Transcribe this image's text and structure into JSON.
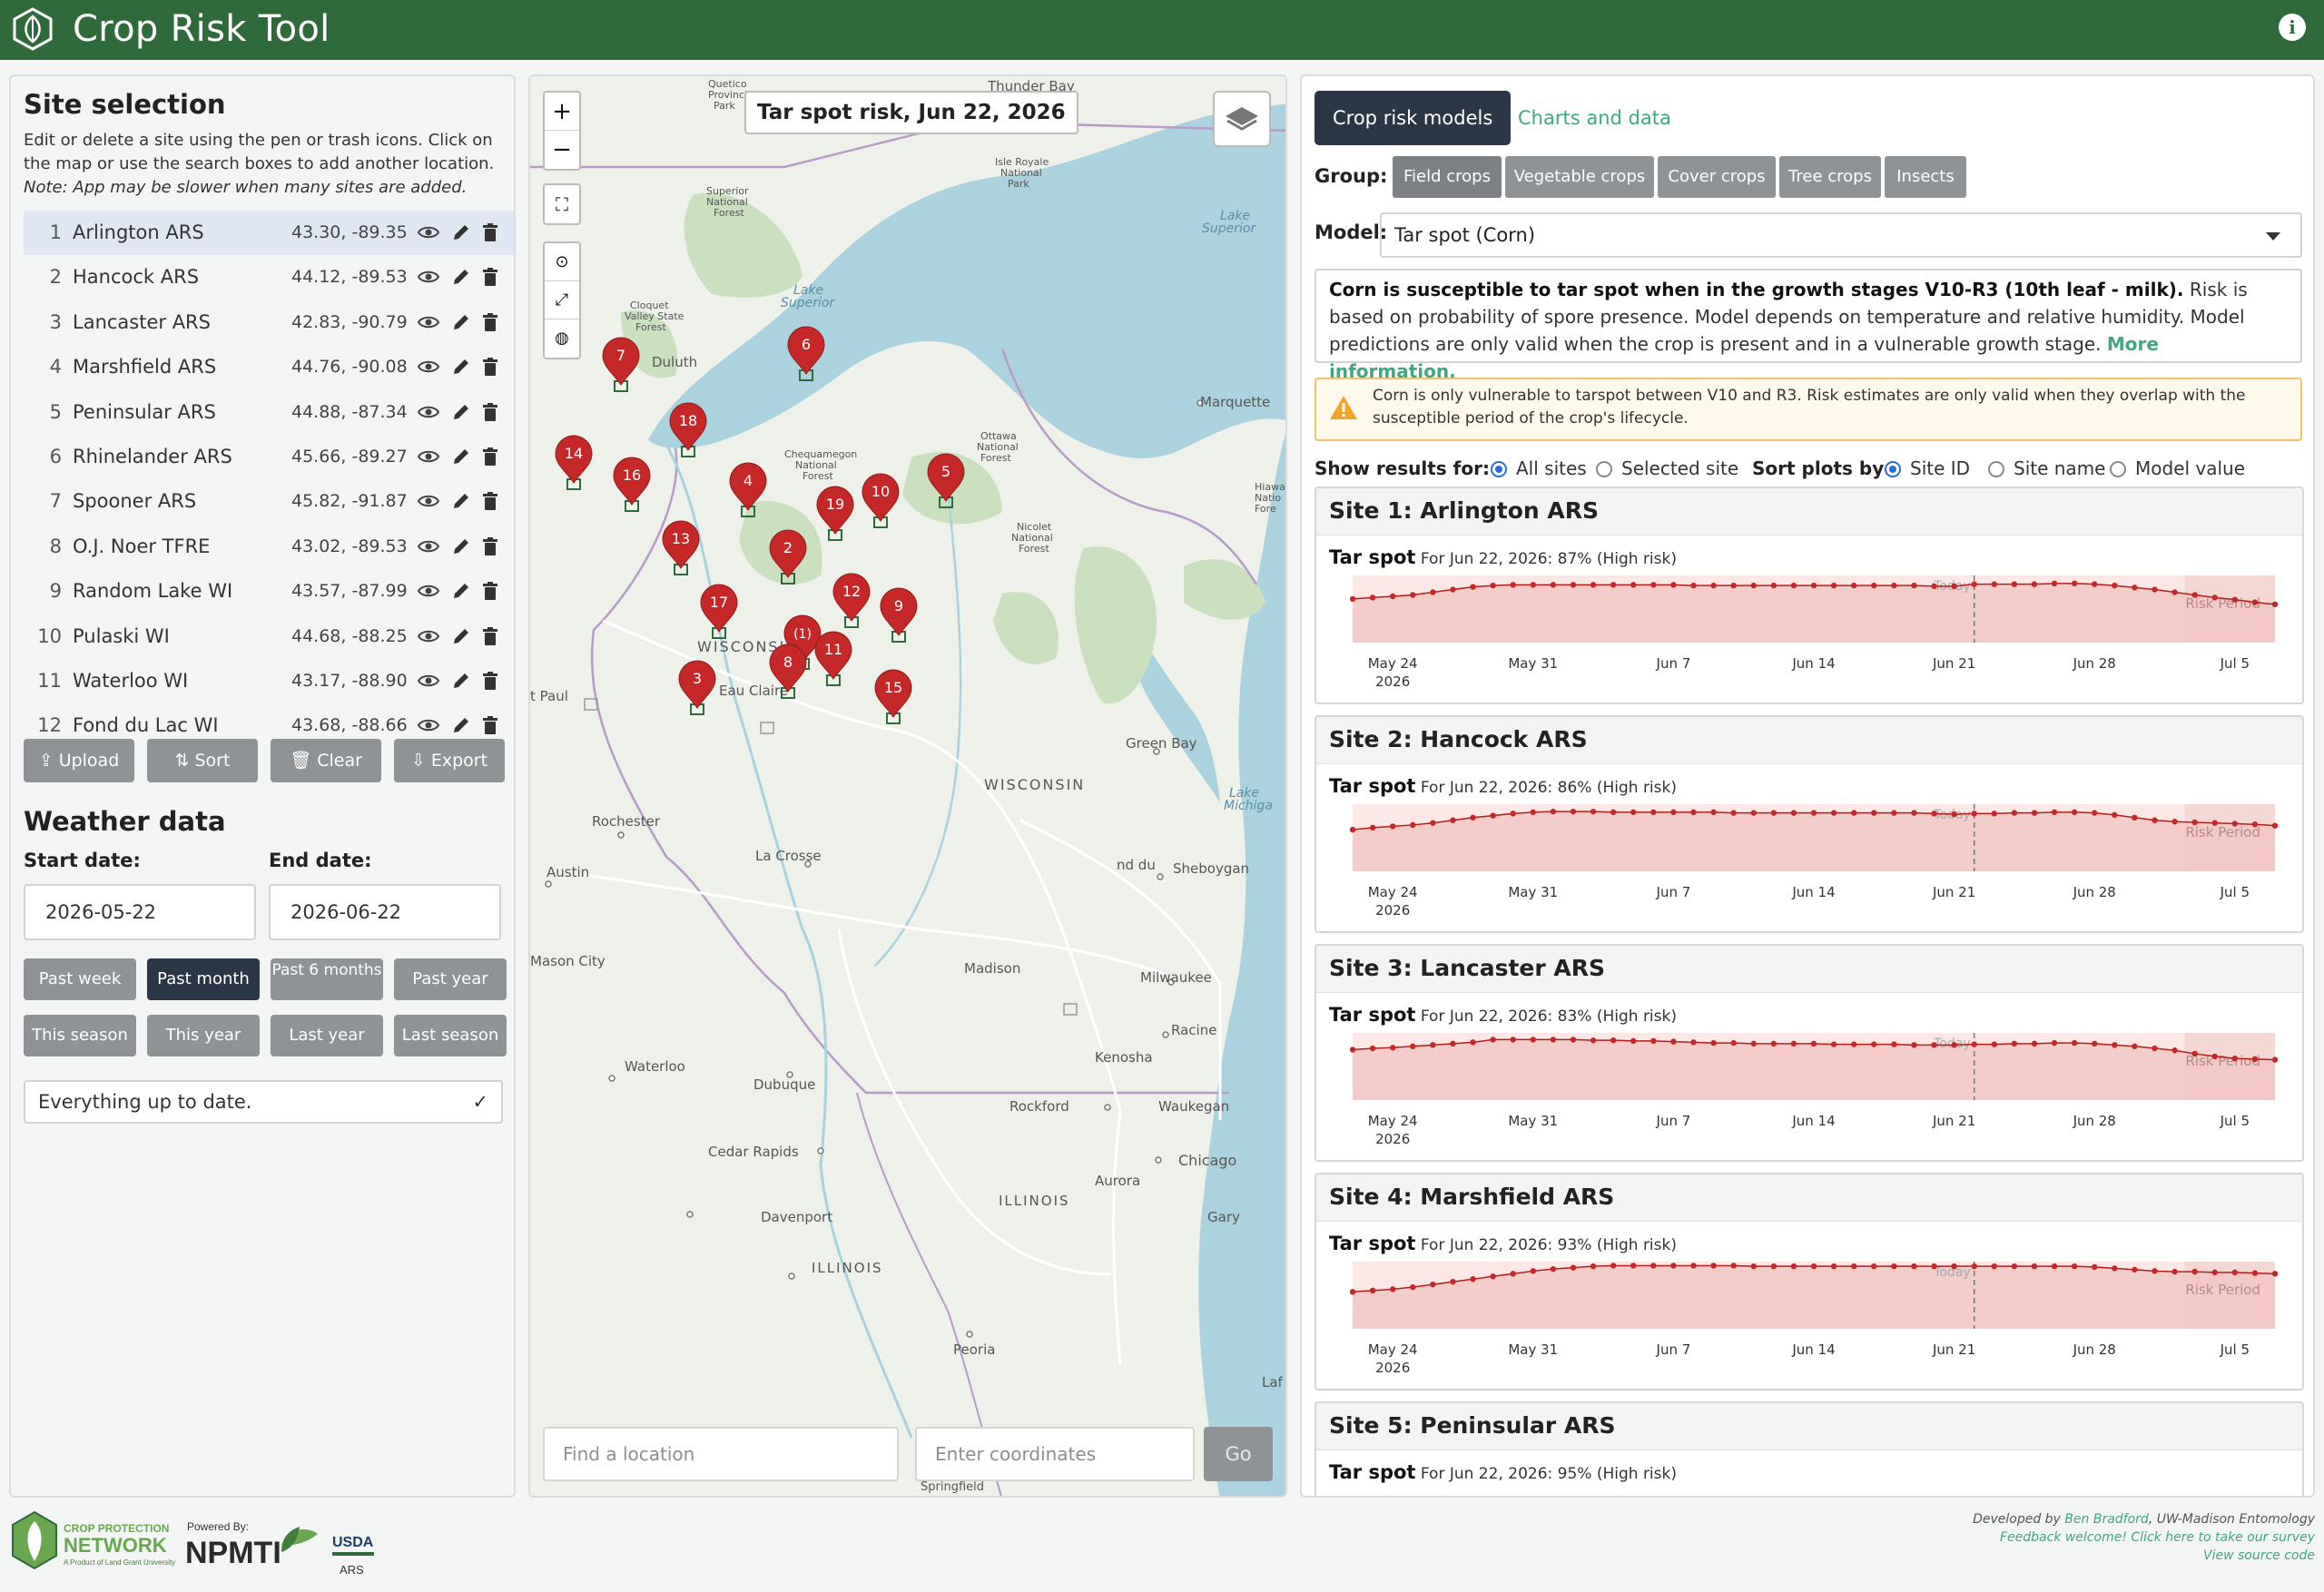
{
  "app": {
    "title": "Crop Risk Tool"
  },
  "site_selection": {
    "heading": "Site selection",
    "help_a": "Edit or delete a site using the pen or trash icons. Click on the map or use the search boxes to add another location.",
    "help_note": "Note: App may be slower when many sites are added.",
    "sites": [
      {
        "num": "1",
        "name": "Arlington ARS",
        "coords": "43.30, -89.35"
      },
      {
        "num": "2",
        "name": "Hancock ARS",
        "coords": "44.12, -89.53"
      },
      {
        "num": "3",
        "name": "Lancaster ARS",
        "coords": "42.83, -90.79"
      },
      {
        "num": "4",
        "name": "Marshfield ARS",
        "coords": "44.76, -90.08"
      },
      {
        "num": "5",
        "name": "Peninsular ARS",
        "coords": "44.88, -87.34"
      },
      {
        "num": "6",
        "name": "Rhinelander ARS",
        "coords": "45.66, -89.27"
      },
      {
        "num": "7",
        "name": "Spooner ARS",
        "coords": "45.82, -91.87"
      },
      {
        "num": "8",
        "name": "O.J. Noer TFRE",
        "coords": "43.02, -89.53"
      },
      {
        "num": "9",
        "name": "Random Lake WI",
        "coords": "43.57, -87.99"
      },
      {
        "num": "10",
        "name": "Pulaski WI",
        "coords": "44.68, -88.25"
      },
      {
        "num": "11",
        "name": "Waterloo WI",
        "coords": "43.17, -88.90"
      },
      {
        "num": "12",
        "name": "Fond du Lac WI",
        "coords": "43.68, -88.66"
      }
    ],
    "buttons": {
      "upload": "Upload",
      "sort": "Sort",
      "clear": "Clear",
      "export": "Export"
    }
  },
  "weather": {
    "heading": "Weather data",
    "start_label": "Start date:",
    "end_label": "End date:",
    "start_value": "2026-05-22",
    "end_value": "2026-06-22",
    "presets": [
      "Past week",
      "Past month",
      "Past 6 months",
      "Past year",
      "This season",
      "This year",
      "Last year",
      "Last season"
    ],
    "active_preset": "Past month",
    "status": "Everything up to date."
  },
  "map": {
    "title": "Tar spot risk, Jun 22, 2026",
    "search_placeholder": "Find a location",
    "coords_placeholder": "Enter coordinates",
    "go": "Go",
    "labels": [
      "Thunder Bay",
      "Lake Superior",
      "Duluth",
      "Marquette",
      "WISCONSIN",
      "Eau Claire",
      "Green Bay",
      "Rochester",
      "La Crosse",
      "Austin",
      "Sheboygan",
      "Madison",
      "Milwaukee",
      "Racine",
      "Kenosha",
      "Mason City",
      "Waterloo",
      "Dubuque",
      "Rockford",
      "Waukegan",
      "Chicago",
      "Cedar Rapids",
      "Aurora",
      "ILLINOIS",
      "Davenport",
      "Gary",
      "Peoria",
      "Lake Michigan",
      "St Paul",
      "Isle Royale National Park",
      "Quetico Provincial Park",
      "Superior National Forest",
      "Cloquet Valley State Forest",
      "Chequamegon National Forest",
      "Ottawa National Forest",
      "Nicolet National Forest",
      "Hiawatha National Forest",
      "Springfield"
    ],
    "pins": [
      "7",
      "6",
      "18",
      "14",
      "16",
      "4",
      "19",
      "10",
      "5",
      "13",
      "2",
      "12",
      "17",
      "9",
      "(1)",
      "11",
      "8",
      "3",
      "15"
    ]
  },
  "results": {
    "tabs": [
      "Crop risk models",
      "Charts and data"
    ],
    "active_tab": "Crop risk models",
    "group_label": "Group:",
    "groups": [
      "Field crops",
      "Vegetable crops",
      "Cover crops",
      "Tree crops",
      "Insects"
    ],
    "active_group": "Field crops",
    "model_label": "Model:",
    "model_value": "Tar spot (Corn)",
    "desc_bold": "Corn is susceptible to tar spot when in the growth stages V10-R3 (10th leaf - milk).",
    "desc_text": " Risk is based on probability of spore presence. Model depends on temperature and relative humidity. Model predictions are only valid when the crop is present and in a vulnerable growth stage. ",
    "desc_link": "More information.",
    "warning": "Corn is only vulnerable to tarspot between V10 and R3. Risk estimates are only valid when they overlap with the susceptible period of the crop's lifecycle.",
    "show_label": "Show results for:",
    "show_options": [
      "All sites",
      "Selected site"
    ],
    "show_selected": "All sites",
    "sort_label": "Sort plots by:",
    "sort_options": [
      "Site ID",
      "Site name",
      "Model value"
    ],
    "sort_selected": "Site ID",
    "chart_model": "Tar spot",
    "today_label": "Today",
    "risk_label": "Risk Period",
    "x_ticks": [
      "May 24",
      "May 31",
      "Jun 7",
      "Jun 14",
      "Jun 21",
      "Jun 28",
      "Jul 5"
    ],
    "x_year": "2026"
  },
  "chart_data": [
    {
      "type": "line",
      "title": "Site 1: Arlington ARS",
      "subtitle": "For Jun 22, 2026: 87% (High risk)",
      "x": [
        "May 22",
        "May 23",
        "May 24",
        "May 25",
        "May 26",
        "May 27",
        "May 28",
        "May 29",
        "May 30",
        "May 31",
        "Jun 1",
        "Jun 2",
        "Jun 3",
        "Jun 4",
        "Jun 5",
        "Jun 6",
        "Jun 7",
        "Jun 8",
        "Jun 9",
        "Jun 10",
        "Jun 11",
        "Jun 12",
        "Jun 13",
        "Jun 14",
        "Jun 15",
        "Jun 16",
        "Jun 17",
        "Jun 18",
        "Jun 19",
        "Jun 20",
        "Jun 21",
        "Jun 22",
        "Jun 23",
        "Jun 24",
        "Jun 25",
        "Jun 26",
        "Jun 27",
        "Jun 28",
        "Jun 29",
        "Jun 30",
        "Jul 1",
        "Jul 2",
        "Jul 3",
        "Jul 4",
        "Jul 5",
        "Jul 6",
        "Jul 7"
      ],
      "values": [
        65,
        67,
        69,
        71,
        75,
        79,
        83,
        85,
        86,
        86,
        86,
        86,
        86,
        86,
        86,
        86,
        86,
        85,
        85,
        85,
        85,
        85,
        85,
        85,
        85,
        85,
        85,
        85,
        85,
        84,
        84,
        87,
        87,
        87,
        87,
        88,
        88,
        87,
        85,
        82,
        79,
        75,
        71,
        67,
        64,
        60,
        57
      ]
    },
    {
      "type": "line",
      "title": "Site 2: Hancock ARS",
      "subtitle": "For Jun 22, 2026: 86% (High risk)",
      "x": [
        "May 22",
        "May 23",
        "May 24",
        "May 25",
        "May 26",
        "May 27",
        "May 28",
        "May 29",
        "May 30",
        "May 31",
        "Jun 1",
        "Jun 2",
        "Jun 3",
        "Jun 4",
        "Jun 5",
        "Jun 6",
        "Jun 7",
        "Jun 8",
        "Jun 9",
        "Jun 10",
        "Jun 11",
        "Jun 12",
        "Jun 13",
        "Jun 14",
        "Jun 15",
        "Jun 16",
        "Jun 17",
        "Jun 18",
        "Jun 19",
        "Jun 20",
        "Jun 21",
        "Jun 22",
        "Jun 23",
        "Jun 24",
        "Jun 25",
        "Jun 26",
        "Jun 27",
        "Jun 28",
        "Jun 29",
        "Jun 30",
        "Jul 1",
        "Jul 2",
        "Jul 3",
        "Jul 4",
        "Jul 5",
        "Jul 6",
        "Jul 7"
      ],
      "values": [
        62,
        65,
        67,
        69,
        72,
        76,
        80,
        83,
        86,
        88,
        89,
        89,
        89,
        88,
        88,
        88,
        88,
        88,
        88,
        87,
        87,
        87,
        87,
        87,
        87,
        87,
        87,
        87,
        87,
        86,
        85,
        86,
        86,
        87,
        87,
        88,
        88,
        87,
        84,
        80,
        76,
        74,
        73,
        72,
        71,
        70,
        68
      ]
    },
    {
      "type": "line",
      "title": "Site 3: Lancaster ARS",
      "subtitle": "For Jun 22, 2026: 83% (High risk)",
      "x": [
        "May 22",
        "May 23",
        "May 24",
        "May 25",
        "May 26",
        "May 27",
        "May 28",
        "May 29",
        "May 30",
        "May 31",
        "Jun 1",
        "Jun 2",
        "Jun 3",
        "Jun 4",
        "Jun 5",
        "Jun 6",
        "Jun 7",
        "Jun 8",
        "Jun 9",
        "Jun 10",
        "Jun 11",
        "Jun 12",
        "Jun 13",
        "Jun 14",
        "Jun 15",
        "Jun 16",
        "Jun 17",
        "Jun 18",
        "Jun 19",
        "Jun 20",
        "Jun 21",
        "Jun 22",
        "Jun 23",
        "Jun 24",
        "Jun 25",
        "Jun 26",
        "Jun 27",
        "Jun 28",
        "Jun 29",
        "Jun 30",
        "Jul 1",
        "Jul 2",
        "Jul 3",
        "Jul 4",
        "Jul 5",
        "Jul 6",
        "Jul 7"
      ],
      "values": [
        75,
        77,
        78,
        80,
        82,
        84,
        86,
        90,
        90,
        90,
        90,
        90,
        89,
        89,
        88,
        88,
        87,
        86,
        85,
        85,
        84,
        84,
        84,
        84,
        83,
        83,
        83,
        83,
        82,
        82,
        82,
        83,
        83,
        84,
        84,
        85,
        85,
        84,
        82,
        80,
        77,
        74,
        69,
        65,
        62,
        61,
        60
      ]
    },
    {
      "type": "line",
      "title": "Site 4: Marshfield ARS",
      "subtitle": "For Jun 22, 2026: 93% (High risk)",
      "x": [
        "May 22",
        "May 23",
        "May 24",
        "May 25",
        "May 26",
        "May 27",
        "May 28",
        "May 29",
        "May 30",
        "May 31",
        "Jun 1",
        "Jun 2",
        "Jun 3",
        "Jun 4",
        "Jun 5",
        "Jun 6",
        "Jun 7",
        "Jun 8",
        "Jun 9",
        "Jun 10",
        "Jun 11",
        "Jun 12",
        "Jun 13",
        "Jun 14",
        "Jun 15",
        "Jun 16",
        "Jun 17",
        "Jun 18",
        "Jun 19",
        "Jun 20",
        "Jun 21",
        "Jun 22",
        "Jun 23",
        "Jun 24",
        "Jun 25",
        "Jun 26",
        "Jun 27",
        "Jun 28",
        "Jun 29",
        "Jun 30",
        "Jul 1",
        "Jul 2",
        "Jul 3",
        "Jul 4",
        "Jul 5",
        "Jul 6",
        "Jul 7"
      ],
      "values": [
        55,
        57,
        59,
        62,
        66,
        70,
        74,
        78,
        82,
        86,
        89,
        91,
        93,
        94,
        94,
        94,
        94,
        94,
        94,
        94,
        93,
        93,
        93,
        93,
        93,
        93,
        93,
        93,
        93,
        93,
        93,
        93,
        93,
        93,
        93,
        93,
        93,
        92,
        90,
        88,
        86,
        85,
        85,
        84,
        84,
        83,
        82
      ]
    },
    {
      "type": "line",
      "title": "Site 5: Peninsular ARS",
      "subtitle": "For Jun 22, 2026: 95% (High risk)",
      "x": [],
      "values": []
    }
  ],
  "footer": {
    "cpn_line1": "CROP PROTECTION",
    "cpn_line2": "NETWORK",
    "cpn_line3": "A Product of Land Grant University",
    "powered_by": "Powered By:",
    "npmti": "NPMTI",
    "usda": "USDA",
    "ars": "ARS",
    "credit_prefix": "Developed by ",
    "credit_name": "Ben Bradford",
    "credit_suffix": ", UW-Madison Entomology",
    "feedback": "Feedback welcome! Click here to take our survey",
    "source": "View source code"
  },
  "colors": {
    "header": "#2f6a3a",
    "accent": "#3fa87d",
    "risk_red": "#c62828",
    "dark_btn": "#2b3647"
  }
}
